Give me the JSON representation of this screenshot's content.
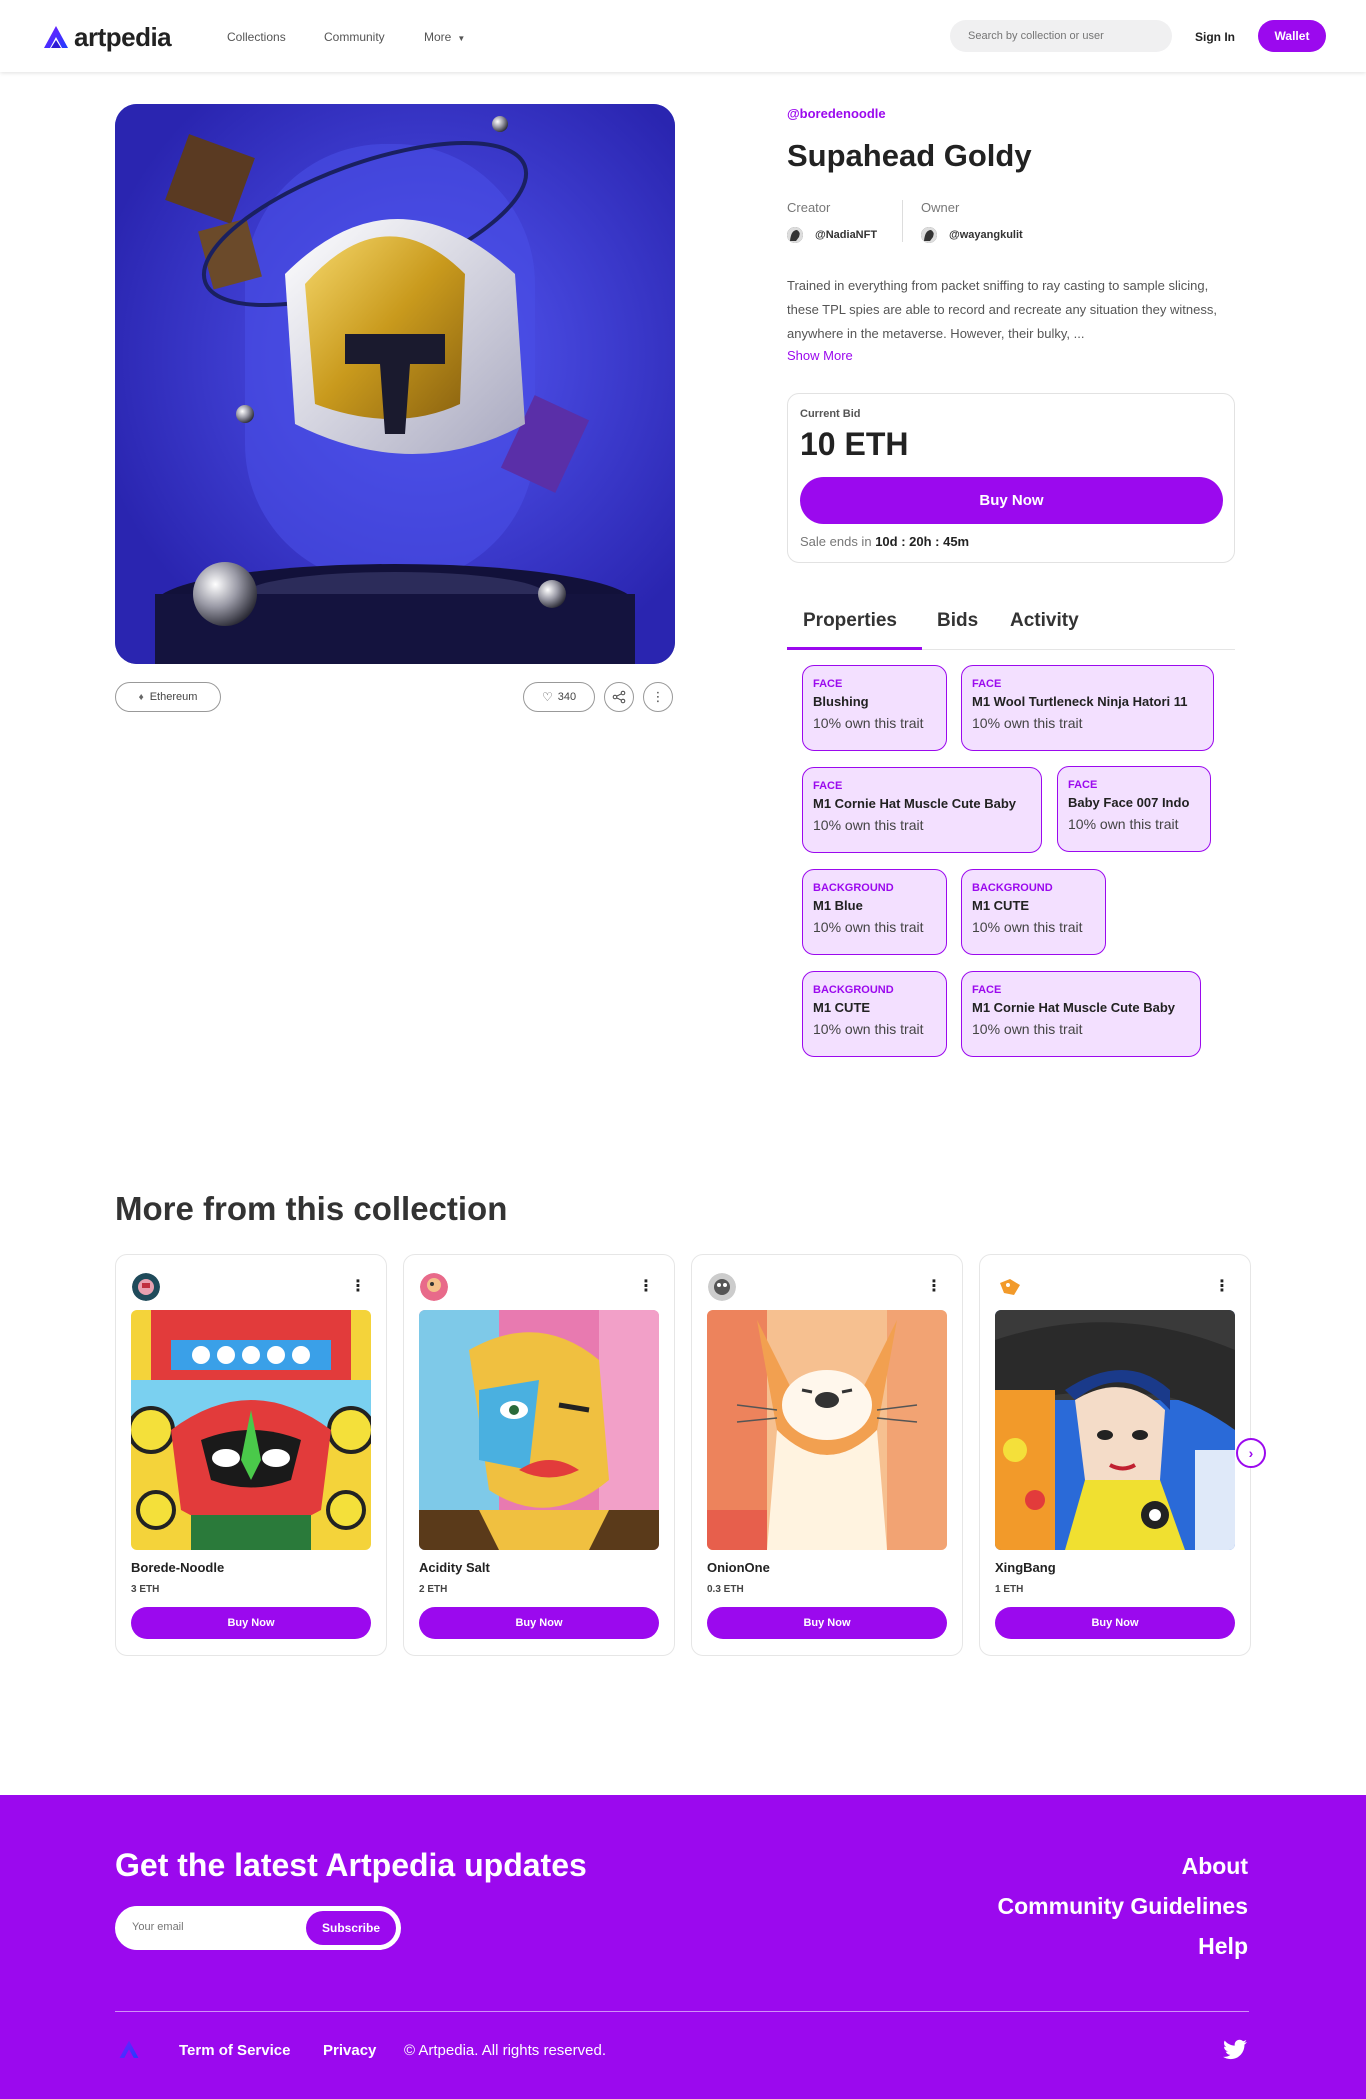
{
  "header": {
    "logo_text": "artpedia",
    "nav": [
      "Collections",
      "Community",
      "More"
    ],
    "search_placeholder": "Search by collection or user",
    "sign_in": "Sign In",
    "wallet": "Wallet"
  },
  "item": {
    "collection_handle": "@boredenoodle",
    "title": "Supahead Goldy",
    "creator_label": "Creator",
    "creator": "@NadiaNFT",
    "owner_label": "Owner",
    "owner": "@wayangkulit",
    "description": "Trained in everything from packet sniffing to ray casting to sample slicing, these TPL spies are able to record and recreate any situation they witness, anywhere in the metaverse. However, their bulky, ...",
    "show_more": "Show More",
    "chain": "Ethereum",
    "likes": "340"
  },
  "bid": {
    "label": "Current Bid",
    "value": "10 ETH",
    "buy_label": "Buy Now",
    "sale_prefix": "Sale ends in",
    "sale_time": "10d : 20h : 45m"
  },
  "tabs": [
    "Properties",
    "Bids",
    "Activity"
  ],
  "traits": [
    {
      "type": "FACE",
      "name": "Blushing",
      "pct": "10% own this trait"
    },
    {
      "type": "FACE",
      "name": "M1 Wool Turtleneck Ninja Hatori 11",
      "pct": "10% own this trait"
    },
    {
      "type": "FACE",
      "name": "M1 Cornie Hat Muscle Cute Baby",
      "pct": "10% own this trait"
    },
    {
      "type": "FACE",
      "name": "Baby Face 007 Indo",
      "pct": "10% own this trait"
    },
    {
      "type": "BACKGROUND",
      "name": "M1 Blue",
      "pct": "10% own this trait"
    },
    {
      "type": "BACKGROUND",
      "name": "M1 CUTE",
      "pct": "10% own this trait"
    },
    {
      "type": "BACKGROUND",
      "name": "M1 CUTE",
      "pct": "10% own this trait"
    },
    {
      "type": "FACE",
      "name": "M1 Cornie Hat Muscle Cute Baby",
      "pct": "10% own this trait"
    }
  ],
  "more": {
    "title": "More from this collection",
    "cards": [
      {
        "name": "Borede-Noodle",
        "price": "3 ETH",
        "buy": "Buy Now"
      },
      {
        "name": "Acidity Salt",
        "price": "2 ETH",
        "buy": "Buy Now"
      },
      {
        "name": "OnionOne",
        "price": "0.3 ETH",
        "buy": "Buy Now"
      },
      {
        "name": "XingBang",
        "price": "1 ETH",
        "buy": "Buy Now"
      }
    ]
  },
  "footer": {
    "title": "Get the latest Artpedia updates",
    "email_placeholder": "Your email",
    "subscribe": "Subscribe",
    "links": [
      "About",
      "Community Guidelines",
      "Help"
    ],
    "bottom_links": [
      "Term of Service",
      "Privacy"
    ],
    "copyright": "© Artpedia. All rights reserved."
  },
  "colors": {
    "accent": "#9b09ee",
    "trait_bg": "#f3e0ff"
  },
  "icons": [
    "logo-icon",
    "chevron-down-icon",
    "ethereum-icon",
    "heart-icon",
    "share-icon",
    "more-vertical-icon",
    "chevron-right-icon",
    "twitter-icon"
  ]
}
